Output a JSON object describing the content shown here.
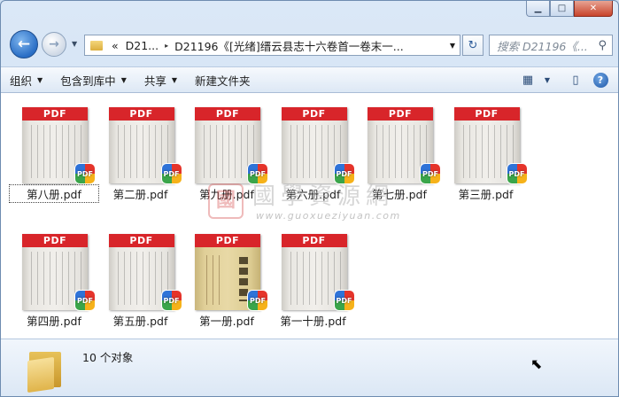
{
  "window": {
    "minimize_glyph": "▁",
    "maximize_glyph": "□",
    "close_glyph": "✕"
  },
  "nav": {
    "back_glyph": "←",
    "forward_glyph": "→",
    "history_glyph": "▼",
    "breadcrumb_overflow": "«",
    "breadcrumb_parent": "D21...",
    "breadcrumb_sep": "▸",
    "breadcrumb_current": "D21196《[光绪]缙云县志十六卷首一卷末一...",
    "address_dropdown_glyph": "▼",
    "refresh_glyph": "↻",
    "search_placeholder": "搜索 D21196《...",
    "search_icon_glyph": "⚲"
  },
  "toolbar": {
    "organize": "组织",
    "include_in_library": "包含到库中",
    "share": "共享",
    "new_folder": "新建文件夹",
    "dropdown_glyph": "▼",
    "view_glyph": "▦",
    "preview_pane_glyph": "▯",
    "help_glyph": "?"
  },
  "files": [
    {
      "name": "第八册.pdf",
      "band": "PDF",
      "badge": "PDF",
      "selected": true
    },
    {
      "name": "第二册.pdf",
      "band": "PDF",
      "badge": "PDF"
    },
    {
      "name": "第九册.pdf",
      "band": "PDF",
      "badge": "PDF"
    },
    {
      "name": "第六册.pdf",
      "band": "PDF",
      "badge": "PDF"
    },
    {
      "name": "第七册.pdf",
      "band": "PDF",
      "badge": "PDF"
    },
    {
      "name": "第三册.pdf",
      "band": "PDF",
      "badge": "PDF"
    },
    {
      "name": "第四册.pdf",
      "band": "PDF",
      "badge": "PDF"
    },
    {
      "name": "第五册.pdf",
      "band": "PDF",
      "badge": "PDF"
    },
    {
      "name": "第一册.pdf",
      "band": "PDF",
      "badge": "PDF",
      "cover": "yellow"
    },
    {
      "name": "第一十册.pdf",
      "band": "PDF",
      "badge": "PDF"
    }
  ],
  "watermark": {
    "seal": "國",
    "title": "國學資源網",
    "url": "www.guoxueziyuan.com"
  },
  "status": {
    "count_text": "10 个对象"
  },
  "colors": {
    "pdf_band": "#d8252a",
    "toolbar_bg": "#dde8f5",
    "content_bg": "#ffffff"
  }
}
